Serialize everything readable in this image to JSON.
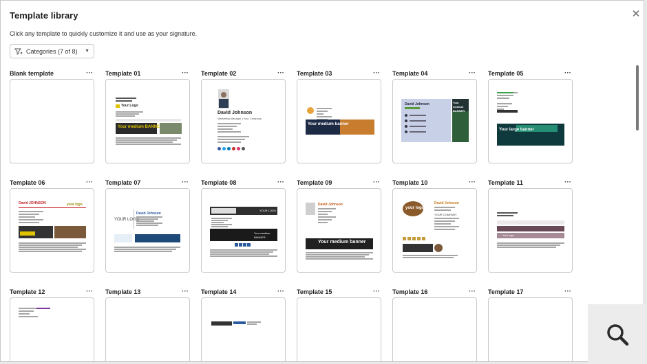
{
  "dialog": {
    "title": "Template library",
    "close_icon": "close-icon",
    "subtitle": "Click any template to quickly customize it and use as your signature."
  },
  "filter": {
    "label": "Categories (7 of 8)",
    "icon": "filter-icon"
  },
  "templates": [
    {
      "name": "Blank template"
    },
    {
      "name": "Template 01"
    },
    {
      "name": "Template 02"
    },
    {
      "name": "Template 03"
    },
    {
      "name": "Template 04"
    },
    {
      "name": "Template 05"
    },
    {
      "name": "Template 06"
    },
    {
      "name": "Template 07"
    },
    {
      "name": "Template 08"
    },
    {
      "name": "Template 09"
    },
    {
      "name": "Template 10"
    },
    {
      "name": "Template 11"
    },
    {
      "name": "Template 12"
    },
    {
      "name": "Template 13"
    },
    {
      "name": "Template 14"
    },
    {
      "name": "Template 15"
    },
    {
      "name": "Template 16"
    },
    {
      "name": "Template 17"
    }
  ],
  "more_label": "···",
  "previews": {
    "t02": {
      "name": "David Johnson",
      "role": "Marketing Manager | Your Company"
    },
    "t01": {
      "logo": "Your Logo",
      "banner": "Your medium BANNER"
    },
    "t03": {
      "banner": "Your medium banner"
    },
    "t04": {
      "name": "David Johnson",
      "banner": "Your medium BANNER"
    },
    "t05": {
      "banner": "Your large banner"
    },
    "t06": {
      "name": "David JOHNSON",
      "logo": "your logo"
    },
    "t07": {
      "logo": "YOUR LOGO",
      "name": "David Johnson"
    },
    "t08": {
      "banner": "Your medium BANNER",
      "logo": "YOUR LOGO"
    },
    "t09": {
      "name": "David Johnson",
      "banner": "Your medium banner"
    },
    "t10": {
      "logo": "your logo",
      "name": "David Johnson",
      "company": "YOUR COMPANY"
    },
    "t11": {
      "logo": "Your logo"
    }
  },
  "colors": {
    "accent_yellow": "#e0c400",
    "accent_red": "#c4222a",
    "dark": "#2b2b2b",
    "t04_panel": "#c8d0e8",
    "t11_band": "#6b4a57"
  },
  "search_fab": {
    "icon": "search-icon"
  }
}
